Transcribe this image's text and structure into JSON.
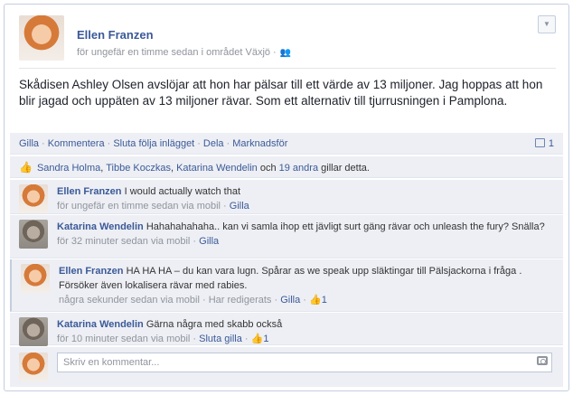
{
  "post": {
    "author": "Ellen Franzen",
    "meta": "för ungefär en timme sedan i området Växjö ·",
    "text": "Skådisen Ashley Olsen avslöjar att hon har pälsar till ett värde av 13 miljoner. Jag hoppas att hon blir jagad och uppäten av 13 miljoner rävar. Som ett alternativ till tjurrusningen i Pamplona."
  },
  "actions": {
    "like": "Gilla",
    "comment": "Kommentera",
    "unfollow": "Sluta följa inlägget",
    "share": "Dela",
    "promote": "Marknadsför",
    "comment_count": "1"
  },
  "likes": {
    "names": [
      "Sandra Holma",
      "Tibbe Koczkas",
      "Katarina Wendelin"
    ],
    "sep1": ",",
    "sep2": ",",
    "and": "och",
    "others": "19 andra",
    "suffix": "gillar detta."
  },
  "comments": [
    {
      "name": "Ellen Franzen",
      "text": "I would actually watch that",
      "time": "för ungefär en timme sedan via mobil",
      "like": "Gilla"
    },
    {
      "name": "Katarina Wendelin",
      "text": "Hahahahahaha.. kan vi samla ihop ett jävligt surt gäng rävar och unleash the fury? Snälla?",
      "time": "för 32 minuter sedan via mobil",
      "like": "Gilla"
    },
    {
      "name": "Ellen Franzen",
      "text": "HA HA HA – du kan vara lugn. Spårar as we speak upp släktingar till Pälsjackorna i fråga . Försöker även lokalisera rävar med rabies.",
      "time": "några sekunder sedan via mobil",
      "edited": "Har redigerats",
      "like": "Gilla",
      "like_count": "1"
    },
    {
      "name": "Katarina Wendelin",
      "text": "Gärna några med skabb också",
      "time": "för 10 minuter sedan via mobil",
      "like": "Sluta gilla",
      "like_count": "1"
    }
  ],
  "composer": {
    "placeholder": "Skriv en kommentar..."
  }
}
